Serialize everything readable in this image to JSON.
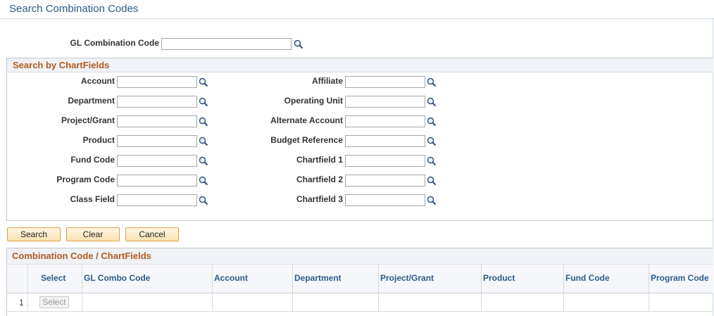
{
  "page": {
    "title": "Search Combination Codes"
  },
  "gl_combo": {
    "label": "GL Combination Code",
    "value": ""
  },
  "search_section": {
    "title": "Search by ChartFields",
    "left_fields": [
      {
        "label": "Account",
        "value": ""
      },
      {
        "label": "Department",
        "value": ""
      },
      {
        "label": "Project/Grant",
        "value": ""
      },
      {
        "label": "Product",
        "value": ""
      },
      {
        "label": "Fund Code",
        "value": ""
      },
      {
        "label": "Program Code",
        "value": ""
      },
      {
        "label": "Class Field",
        "value": ""
      }
    ],
    "right_fields": [
      {
        "label": "Affiliate",
        "value": ""
      },
      {
        "label": "Operating Unit",
        "value": ""
      },
      {
        "label": "Alternate Account",
        "value": ""
      },
      {
        "label": "Budget Reference",
        "value": ""
      },
      {
        "label": "Chartfield 1",
        "value": ""
      },
      {
        "label": "Chartfield 2",
        "value": ""
      },
      {
        "label": "Chartfield 3",
        "value": ""
      }
    ]
  },
  "buttons": {
    "search": "Search",
    "clear": "Clear",
    "cancel": "Cancel"
  },
  "results": {
    "title": "Combination Code / ChartFields",
    "columns": [
      "Select",
      "GL Combo Code",
      "Account",
      "Department",
      "Project/Grant",
      "Product",
      "Fund Code",
      "Program Code"
    ],
    "rows": [
      {
        "num": "1",
        "select_label": "Select"
      }
    ]
  },
  "icons": {
    "lookup": "magnifier-lookup-icon"
  },
  "colors": {
    "title": "#2f5a8a",
    "section_title": "#b35a1f",
    "button_border": "#d9a24d"
  }
}
